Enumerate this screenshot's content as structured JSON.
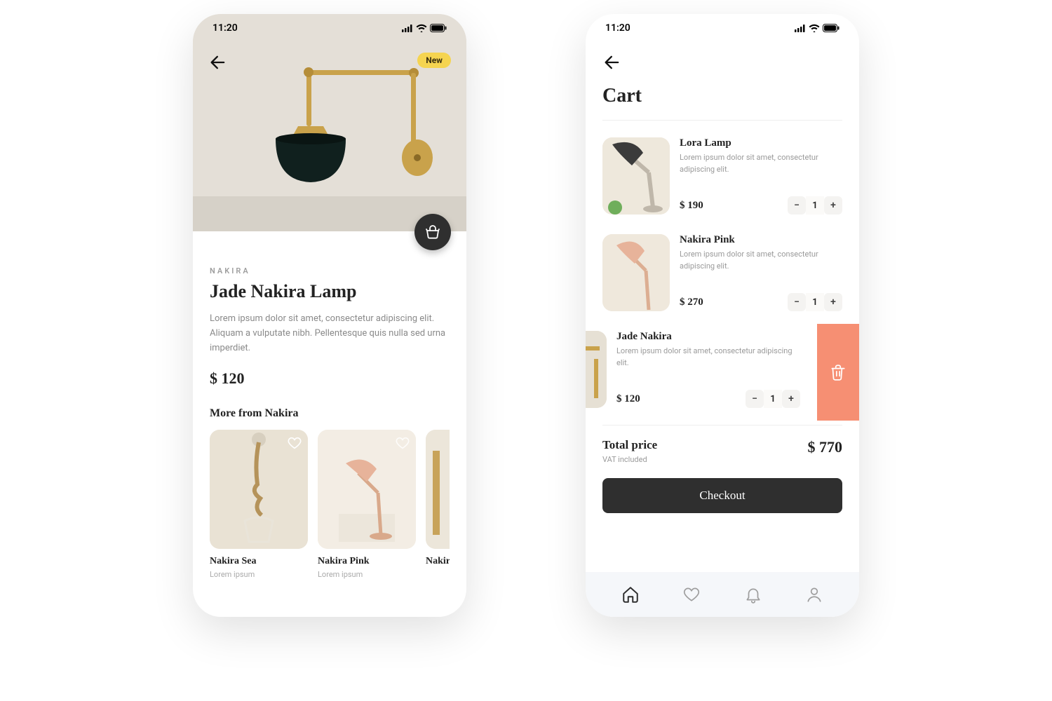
{
  "status": {
    "time": "11:20"
  },
  "product": {
    "badge": "New",
    "brand": "NAKIRA",
    "title": "Jade Nakira Lamp",
    "description": "Lorem ipsum dolor sit amet, consectetur adipiscing elit. Aliquam a vulputate nibh. Pellentesque quis nulla sed urna imperdiet.",
    "price": "$ 120",
    "more_title": "More from Nakira",
    "related": [
      {
        "name": "Nakira Sea",
        "sub": "Lorem ipsum"
      },
      {
        "name": "Nakira Pink",
        "sub": "Lorem ipsum"
      },
      {
        "name": "Nakira G",
        "sub": ""
      }
    ]
  },
  "cart": {
    "title": "Cart",
    "items": [
      {
        "name": "Lora Lamp",
        "desc": "Lorem ipsum dolor sit amet, consectetur adipiscing elit.",
        "price": "$ 190",
        "qty": "1"
      },
      {
        "name": "Nakira Pink",
        "desc": "Lorem ipsum dolor sit amet, consectetur adipiscing elit.",
        "price": "$ 270",
        "qty": "1"
      },
      {
        "name": "Jade Nakira",
        "desc": "Lorem ipsum dolor sit amet, consectetur adipiscing elit.",
        "price": "$ 120",
        "qty": "1"
      }
    ],
    "total_label": "Total price",
    "total_sub": "VAT included",
    "total_price": "$ 770",
    "checkout": "Checkout"
  }
}
